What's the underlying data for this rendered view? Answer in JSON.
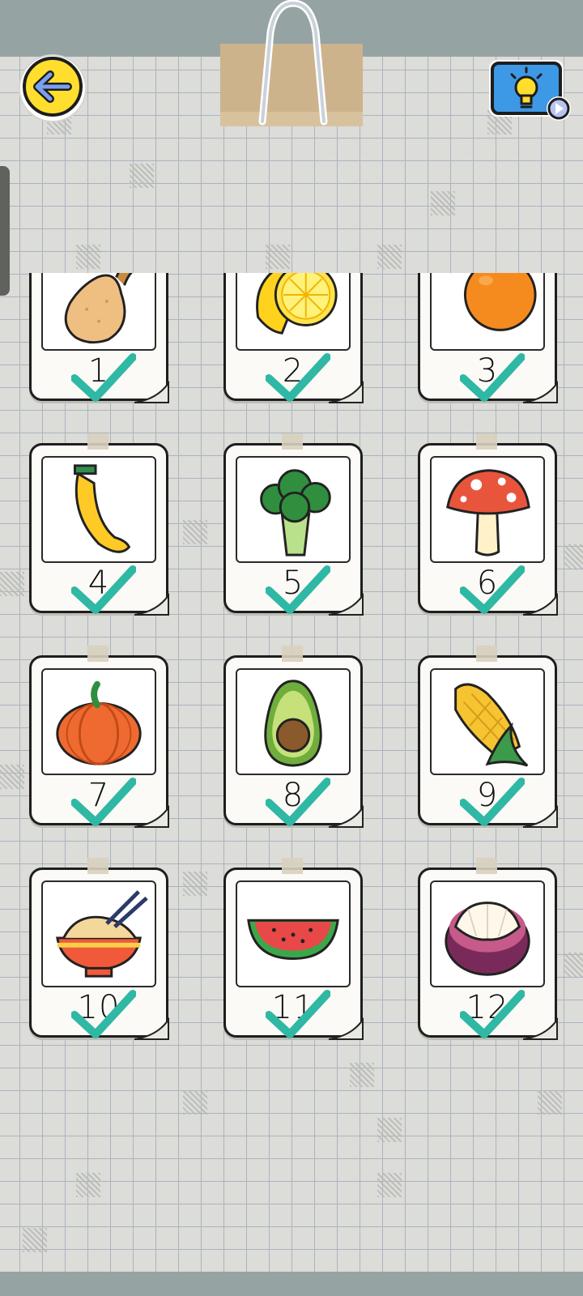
{
  "header": {
    "back_icon": "arrow-left-icon",
    "hint_icon": "lightbulb-video-icon",
    "clip_icon": "binder-clip-icon"
  },
  "colors": {
    "accent_yellow": "#ffde2e",
    "hint_blue": "#3d98e6",
    "check_green": "#2fb8a4",
    "grid_line": "#a9b4c0",
    "bar": "#95a3a3"
  },
  "levels": [
    {
      "number": "1",
      "item": "pear",
      "completed": true
    },
    {
      "number": "2",
      "item": "lemon",
      "completed": true
    },
    {
      "number": "3",
      "item": "orange",
      "completed": true
    },
    {
      "number": "4",
      "item": "banana",
      "completed": true
    },
    {
      "number": "5",
      "item": "broccoli",
      "completed": true
    },
    {
      "number": "6",
      "item": "mushroom",
      "completed": true
    },
    {
      "number": "7",
      "item": "pumpkin",
      "completed": true
    },
    {
      "number": "8",
      "item": "avocado",
      "completed": true
    },
    {
      "number": "9",
      "item": "corn",
      "completed": true
    },
    {
      "number": "10",
      "item": "noodles",
      "completed": true
    },
    {
      "number": "11",
      "item": "watermelon",
      "completed": true
    },
    {
      "number": "12",
      "item": "mangosteen",
      "completed": true
    }
  ]
}
